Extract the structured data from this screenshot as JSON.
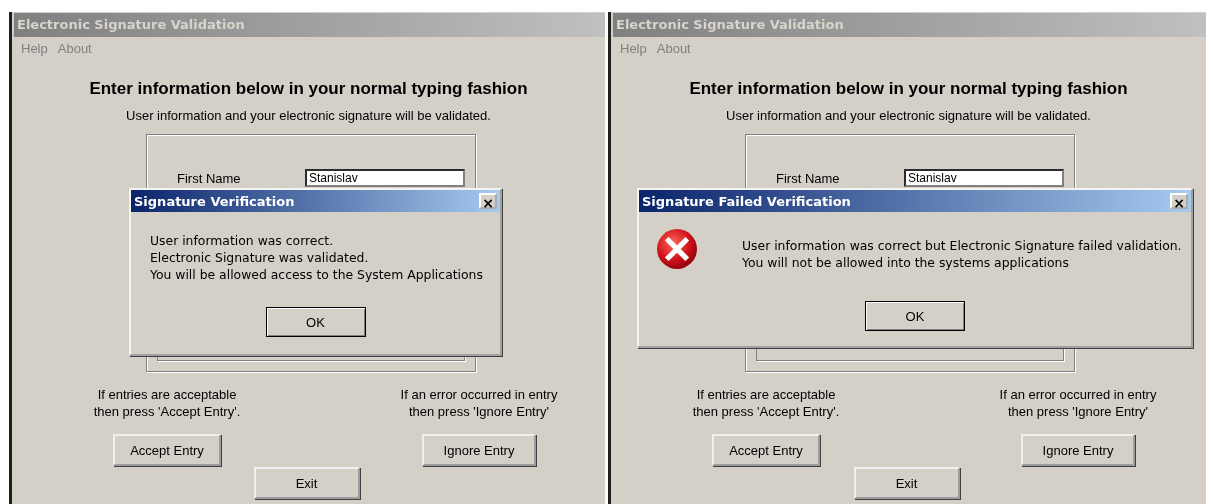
{
  "panels": [
    {
      "window": {
        "title": "Electronic Signature Validation"
      },
      "menu": [
        "Help",
        "About"
      ],
      "heading": "Enter information below in your normal typing fashion",
      "subtitle": "User information and your electronic signature will be validated.",
      "form": {
        "label": "First Name",
        "value": "Stanislav"
      },
      "accept_note": [
        "If entries are acceptable",
        "then press 'Accept Entry'."
      ],
      "ignore_note": [
        "If an error occurred in entry",
        "then press 'Ignore Entry'"
      ],
      "buttons": {
        "accept": "Accept Entry",
        "ignore": "Ignore Entry",
        "exit": "Exit"
      },
      "dialog": {
        "kind": "plain",
        "title": "Signature Verification",
        "close": "×",
        "lines": [
          "User information was correct.",
          "Electronic Signature was validated.",
          "You will be allowed access to the System Applications"
        ],
        "ok": "OK"
      }
    },
    {
      "window": {
        "title": "Electronic Signature Validation"
      },
      "menu": [
        "Help",
        "About"
      ],
      "heading": "Enter information below in your normal typing fashion",
      "subtitle": "User information and your electronic signature will be validated.",
      "form": {
        "label": "First Name",
        "value": "Stanislav"
      },
      "accept_note": [
        "If entries are acceptable",
        "then press 'Accept Entry'."
      ],
      "ignore_note": [
        "If an error occurred in entry",
        "then press 'Ignore Entry'"
      ],
      "buttons": {
        "accept": "Accept Entry",
        "ignore": "Ignore Entry",
        "exit": "Exit"
      },
      "dialog": {
        "kind": "error",
        "title": "Signature Failed Verification",
        "close": "×",
        "lines": [
          "User information was correct but Electronic Signature failed validation.",
          "You will not be allowed into the systems applications"
        ],
        "ok": "OK"
      }
    }
  ]
}
